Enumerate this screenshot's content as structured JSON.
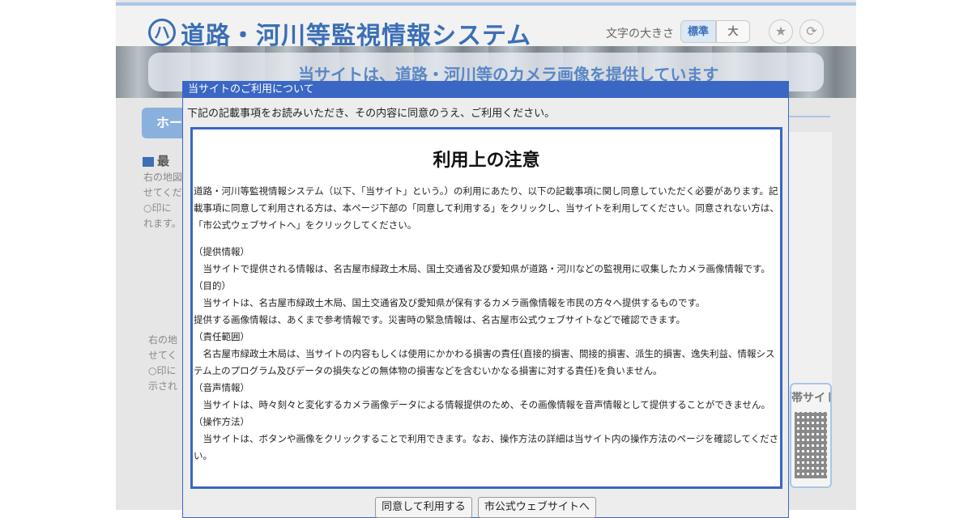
{
  "header": {
    "logo_glyph": "ハ",
    "site_title": "道路・河川等監視情報システム",
    "font_size_label": "文字の大きさ",
    "font_size_normal": "標準",
    "font_size_large": "大",
    "star_glyph": "★",
    "reload_glyph": "⟳"
  },
  "banner": {
    "text_main": "当サイトは、道路・河川等のカメラ画像を提供しています"
  },
  "sidebar": {
    "home_label": "ホー",
    "section_head": "最",
    "text_1": "右の地図\nせてくだ\n○印に\nれます。",
    "text_2": "右の地\nせてく\n○印に\n示され"
  },
  "right": {
    "mobile_label": "帯サイト"
  },
  "dialog": {
    "title": "当サイトのご利用について",
    "intro": "下記の記載事項をお読みいただき、その内容に同意のうえ、ご利用ください。",
    "heading": "利用上の注意",
    "intro_paragraph": "道路・河川等監視情報システム（以下、「当サイト」という。）の利用にあたり、以下の記載事項に関し同意していただく必要があります。記載事項に同意して利用される方は、本ページ下部の「同意して利用する」をクリックし、当サイトを利用してください。同意されない方は、「市公式ウェブサイトへ」をクリックしてください。",
    "sections": [
      {
        "head": "（提供情報）",
        "body": "当サイトで提供される情報は、名古屋市緑政土木局、国土交通省及び愛知県が道路・河川などの監視用に収集したカメラ画像情報です。"
      },
      {
        "head": "（目的）",
        "body": "当サイトは、名古屋市緑政土木局、国土交通省及び愛知県が保有するカメラ画像情報を市民の方々へ提供するものです。",
        "extra": "提供する画像情報は、あくまで参考情報です。災害時の緊急情報は、名古屋市公式ウェブサイトなどで確認できます。"
      },
      {
        "head": "（責任範囲）",
        "body": "名古屋市緑政土木局は、当サイトの内容もしくは使用にかかわる損害の責任(直接的損害、間接的損害、派生的損害、逸失利益、情報システム上のプログラム及びデータの損失などの無体物の損害などを含むいかなる損害に対する責任)を負いません。"
      },
      {
        "head": "（音声情報）",
        "body": "当サイトは、時々刻々と変化するカメラ画像データによる情報提供のため、その画像情報を音声情報として提供することができません。"
      },
      {
        "head": "（操作方法）",
        "body": "当サイトは、ボタンや画像をクリックすることで利用できます。なお、操作方法の詳細は当サイト内の操作方法のページを確認してください。"
      }
    ],
    "agree_button": "同意して利用する",
    "city_site_button": "市公式ウェブサイトへ"
  }
}
